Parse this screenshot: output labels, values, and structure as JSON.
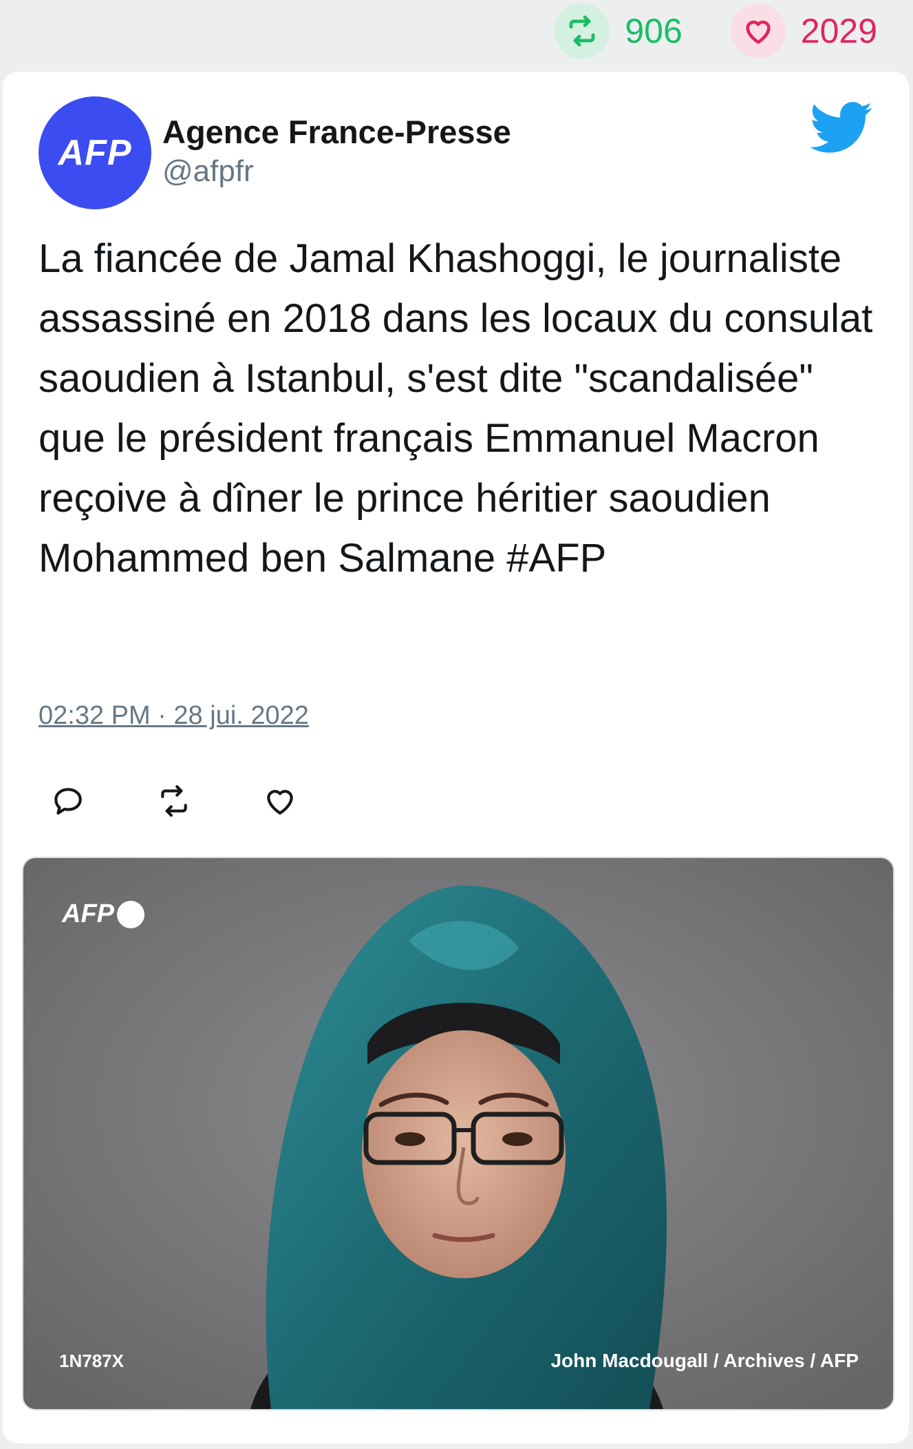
{
  "stats": {
    "retweet_count": "906",
    "like_count": "2029"
  },
  "author": {
    "name": "Agence France-Presse",
    "handle": "@afpfr",
    "avatar_text": "AFP"
  },
  "tweet": {
    "text": "La fiancée de Jamal Khashoggi, le journaliste assassiné en 2018 dans les locaux du consulat saoudien à Istanbul, s'est dite \"scandalisée\" que le président français Emmanuel Macron reçoive à dîner le prince héritier saoudien Mohammed ben Salmane #AFP",
    "date": "02:32 PM · 28 jui. 2022"
  },
  "media": {
    "watermark": "AFP",
    "photo_id": "1N787X",
    "credit": "John Macdougall / Archives / AFP"
  },
  "colors": {
    "retweet": "#17bf63",
    "like": "#e0245e",
    "avatar": "#3b4cf0",
    "twitter_blue": "#1da1f2"
  },
  "icons": {
    "retweet": "retweet-icon",
    "like": "heart-icon",
    "reply": "reply-icon",
    "brand": "twitter-bird-icon"
  }
}
